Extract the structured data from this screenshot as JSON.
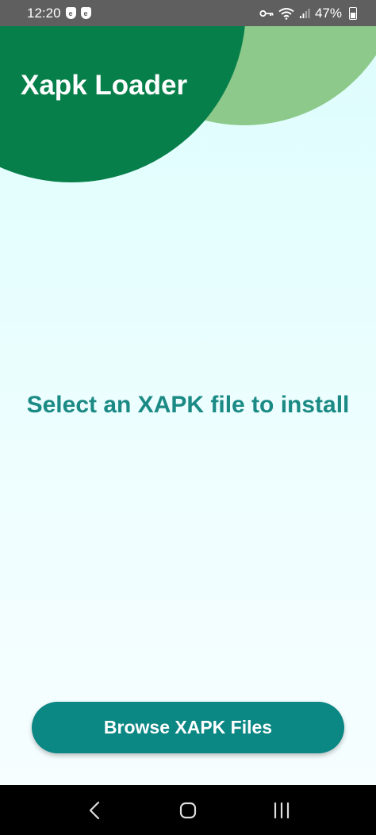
{
  "status_bar": {
    "time": "12:20",
    "battery": "47%",
    "left_icons": [
      "shield-icon",
      "shield-icon"
    ],
    "right_icons": [
      "key-icon",
      "wifi-icon",
      "signal-icon",
      "battery-icon"
    ]
  },
  "header": {
    "title": "Xapk Loader"
  },
  "main": {
    "prompt": "Select an XAPK file to install"
  },
  "actions": {
    "browse_label": "Browse XAPK Files"
  },
  "navigation": {
    "buttons": [
      "back-icon",
      "home-icon",
      "recents-icon"
    ]
  },
  "colors": {
    "header_dark_green": "#077f4a",
    "header_light_green": "#8cc98a",
    "accent_teal": "#0b8784",
    "prompt_text": "#1b8a84",
    "background": "#e6feff"
  }
}
